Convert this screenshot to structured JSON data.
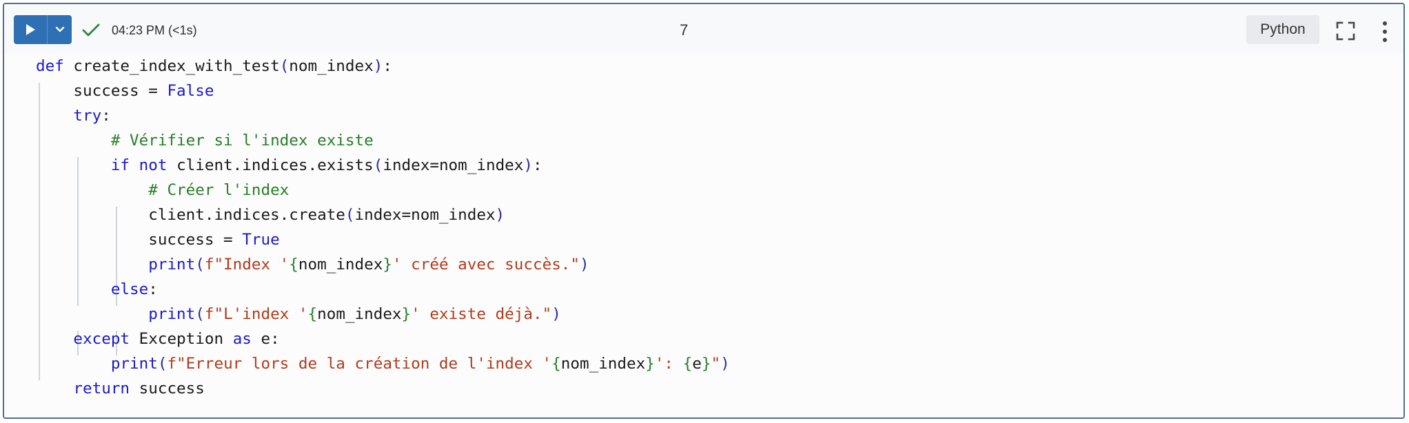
{
  "toolbar": {
    "run_icon": "play-icon",
    "menu_icon": "chevron-down-icon",
    "status_icon": "check-icon",
    "status_color": "#2e8540",
    "accent_color": "#2f6fb3",
    "timestamp": "04:23 PM (<1s)",
    "execution_count": "7",
    "language": "Python",
    "expand_icon": "expand-icon",
    "more_icon": "more-vertical-icon"
  },
  "code": {
    "lines": [
      "def create_index_with_test(nom_index):",
      "    success = False",
      "    try:",
      "        # Vérifier si l'index existe",
      "        if not client.indices.exists(index=nom_index):",
      "            # Créer l'index",
      "            client.indices.create(index=nom_index)",
      "            success = True",
      "            print(f\"Index '{nom_index}' créé avec succès.\")",
      "        else:",
      "            print(f\"L'index '{nom_index}' existe déjà.\")",
      "    except Exception as e:",
      "        print(f\"Erreur lors de la création de l'index '{nom_index}': {e}\")",
      "    return success"
    ]
  }
}
